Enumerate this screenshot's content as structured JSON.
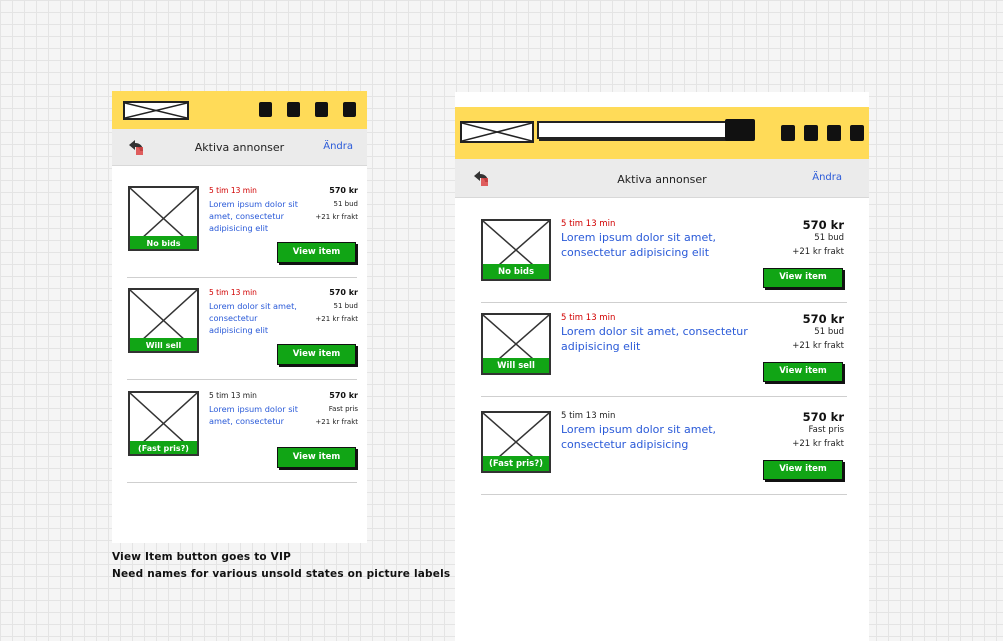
{
  "nav": {
    "title": "Aktiva annonser",
    "edit_label": "Ändra"
  },
  "small": {
    "items": [
      {
        "time": "5 tim 13 min",
        "time_color": "red",
        "title_lines": [
          "Lorem ipsum dolor sit",
          "amet, consectetur",
          "adipisicing elit"
        ],
        "price": "570 kr",
        "bids": "51 bud",
        "shipping": "+21 kr frakt",
        "label": "No bids",
        "button": "View item"
      },
      {
        "time": "5 tim 13 min",
        "time_color": "red",
        "title_lines": [
          "Lorem dolor sit amet,",
          "consectetur",
          "adipisicing elit"
        ],
        "price": "570 kr",
        "bids": "51 bud",
        "shipping": "+21 kr frakt",
        "label": "Will sell",
        "button": "View item"
      },
      {
        "time": "5 tim 13 min",
        "time_color": "black",
        "title_lines": [
          "Lorem ipsum dolor sit",
          "amet, consectetur"
        ],
        "price": "570 kr",
        "bids": "Fast pris",
        "shipping": "+21 kr frakt",
        "label": "(Fast pris?)",
        "button": "View item"
      }
    ]
  },
  "large": {
    "items": [
      {
        "time": "5 tim 13 min",
        "time_color": "red",
        "title_lines": [
          "Lorem ipsum dolor sit amet,",
          "consectetur adipisicing elit"
        ],
        "price": "570 kr",
        "bids": "51 bud",
        "shipping": "+21 kr frakt",
        "label": "No bids",
        "button": "View item"
      },
      {
        "time": "5 tim 13 min",
        "time_color": "red",
        "title_lines": [
          "Lorem dolor sit amet, consectetur",
          "adipisicing elit"
        ],
        "price": "570 kr",
        "bids": "51 bud",
        "shipping": "+21 kr frakt",
        "label": "Will sell",
        "button": "View item"
      },
      {
        "time": "5 tim 13 min",
        "time_color": "black",
        "title_lines": [
          "Lorem ipsum dolor sit amet,",
          "consectetur adipisicing"
        ],
        "price": "570 kr",
        "bids": "Fast pris",
        "shipping": "+21 kr frakt",
        "label": "(Fast pris?)",
        "button": "View item"
      }
    ]
  },
  "notes": [
    "View Item button goes to VIP",
    "Need names for various unsold states on picture labels"
  ],
  "colors": {
    "topbar": "#ffdb58",
    "accent_green": "#11a515",
    "link_blue": "#2a5ad8",
    "time_red": "#d10000"
  }
}
